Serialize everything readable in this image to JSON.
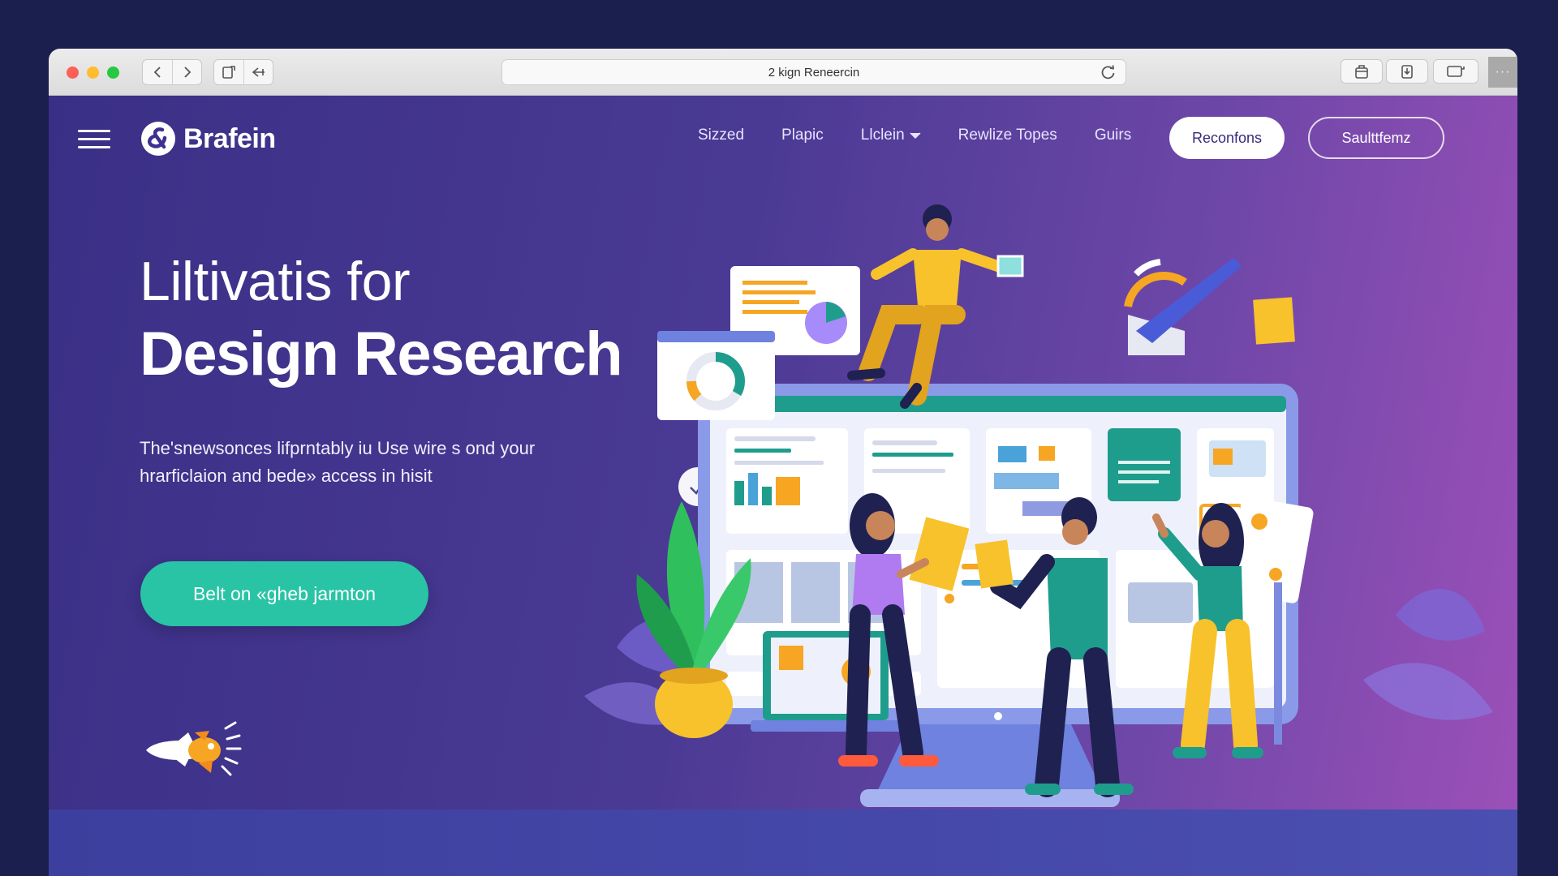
{
  "browser": {
    "url": "2 kign Reneercin",
    "more_label": "···"
  },
  "header": {
    "brand": "Brafein",
    "nav": [
      {
        "label": "Sizzed"
      },
      {
        "label": "Plapic"
      },
      {
        "label": "Llclein"
      },
      {
        "label": "Rewlize Topes"
      },
      {
        "label": "Guirs"
      }
    ],
    "primary_button": "Reconfons",
    "secondary_button": "Saulttfemz"
  },
  "hero": {
    "title_light": "Liltivatis for",
    "title_bold": "Design Research",
    "subtitle_line1": "The'snewsonces lifprntably iu Use wire s ond your",
    "subtitle_line2": "hrarficlaion and bede» access in hisit",
    "cta": "Belt on «gheb jarmton"
  },
  "colors": {
    "accent": "#28c4a5",
    "background_start": "#3a2f86",
    "background_end": "#9b50b8",
    "outer_bg": "#1b1f4d"
  },
  "icons": {
    "logo": "brand-ampersand-icon",
    "menu": "hamburger-icon",
    "check": "check-icon",
    "rocket": "rocket-icon"
  }
}
